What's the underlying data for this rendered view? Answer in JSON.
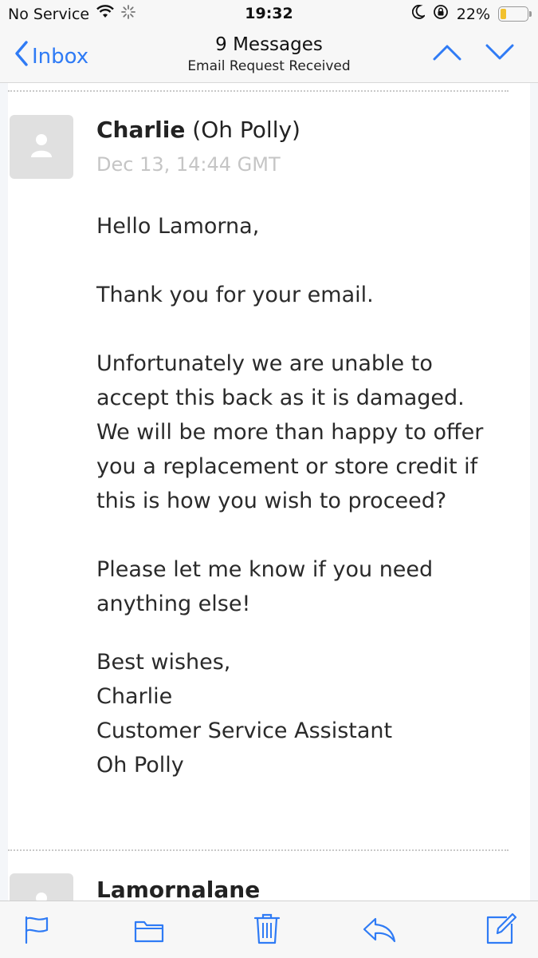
{
  "status_bar": {
    "carrier": "No Service",
    "time": "19:32",
    "battery_percent": "22%",
    "battery_level": 0.22,
    "icons": [
      "wifi-icon",
      "activity-spinner-icon",
      "do-not-disturb-moon-icon",
      "orientation-lock-icon",
      "battery-icon"
    ]
  },
  "nav": {
    "back_label": "Inbox",
    "title": "9 Messages",
    "subtitle": "Email Request Received"
  },
  "messages": [
    {
      "sender_name": "Charlie",
      "sender_org": "(Oh Polly)",
      "date": "Dec 13, 14:44 GMT",
      "body": {
        "greeting": "Hello Lamorna,",
        "thanks": "Thank you for your email.",
        "paragraph": [
          "Unfortunately we are unable to",
          "accept this back as it is damaged.",
          "We will be more than happy to offer",
          "you a replacement or store credit if",
          "this is how you wish to proceed?"
        ],
        "closing_request": [
          "Please let me know if you need",
          "anything else!"
        ],
        "signature": [
          "Best wishes,",
          "Charlie",
          "Customer Service Assistant",
          "Oh Polly"
        ]
      }
    },
    {
      "sender_name": "Lamornalane"
    }
  ],
  "toolbar": {
    "icons": [
      "flag-icon",
      "folder-icon",
      "trash-icon",
      "reply-icon",
      "compose-icon"
    ]
  },
  "colors": {
    "accent": "#2f7bf5",
    "battery": "#f2c12e",
    "date_text": "#c5c5c5"
  }
}
